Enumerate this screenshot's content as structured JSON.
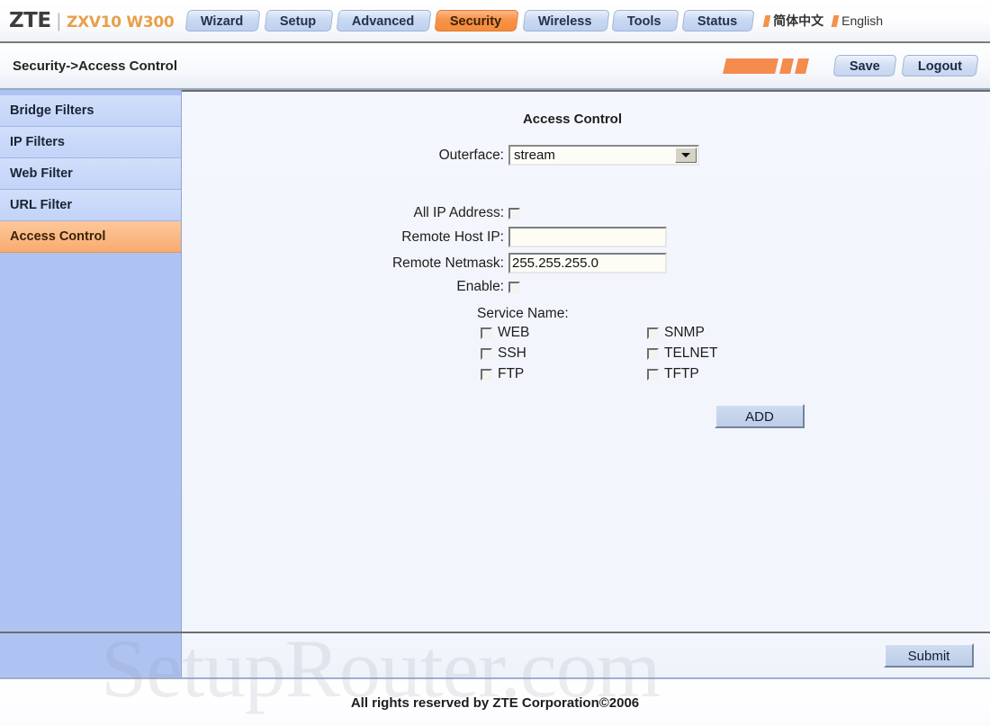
{
  "header": {
    "brand_name": "ZTE",
    "brand_separator": "|",
    "brand_model": "ZXV10 W300",
    "nav_tabs": [
      {
        "label": "Wizard",
        "active": false
      },
      {
        "label": "Setup",
        "active": false
      },
      {
        "label": "Advanced",
        "active": false
      },
      {
        "label": "Security",
        "active": true
      },
      {
        "label": "Wireless",
        "active": false
      },
      {
        "label": "Tools",
        "active": false
      },
      {
        "label": "Status",
        "active": false
      }
    ],
    "languages": [
      {
        "label": "简体中文"
      },
      {
        "label": "English"
      }
    ]
  },
  "subbar": {
    "breadcrumb": "Security->Access Control",
    "save_label": "Save",
    "logout_label": "Logout"
  },
  "sidebar": {
    "items": [
      {
        "label": "Bridge Filters",
        "active": false
      },
      {
        "label": "IP Filters",
        "active": false
      },
      {
        "label": "Web Filter",
        "active": false
      },
      {
        "label": "URL Filter",
        "active": false
      },
      {
        "label": "Access Control",
        "active": true
      }
    ]
  },
  "main": {
    "title": "Access Control",
    "outerface": {
      "label": "Outerface:",
      "value": "stream",
      "options": [
        "stream"
      ]
    },
    "all_ip_address": {
      "label": "All IP Address:",
      "checked": false
    },
    "remote_host_ip": {
      "label": "Remote Host IP:",
      "value": "",
      "placeholder": ""
    },
    "remote_netmask": {
      "label": "Remote Netmask:",
      "value": "255.255.255.0",
      "placeholder": ""
    },
    "enable": {
      "label": "Enable:",
      "checked": false
    },
    "service_name_label": "Service Name:",
    "services": [
      {
        "label": "WEB",
        "checked": false
      },
      {
        "label": "SNMP",
        "checked": false
      },
      {
        "label": "SSH",
        "checked": false
      },
      {
        "label": "TELNET",
        "checked": false
      },
      {
        "label": "FTP",
        "checked": false
      },
      {
        "label": "TFTP",
        "checked": false
      }
    ],
    "add_label": "ADD"
  },
  "footer": {
    "submit_label": "Submit",
    "copyright": "All rights reserved by ZTE Corporation©2006",
    "watermark": "SetupRouter.com"
  },
  "colors": {
    "accent_orange": "#f58b3c",
    "tab_blue": "#c9d9f2",
    "sidebar_blue": "#aec3f2",
    "content_bg": "#f2f6fc"
  }
}
